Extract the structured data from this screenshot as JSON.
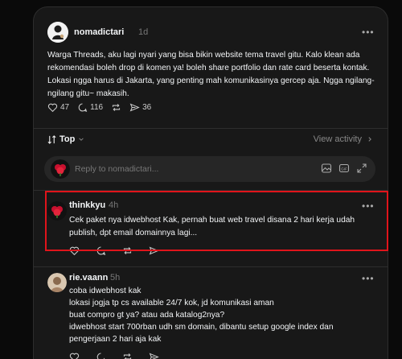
{
  "post": {
    "username": "nomadictari",
    "time": "1d",
    "more": "•••",
    "text": "Warga Threads, aku lagi nyari yang bisa bikin website tema travel gitu. Kalo klean ada rekomendasi boleh drop di komen ya! boleh share portfolio dan rate card beserta kontak. Lokasi ngga harus di Jakarta, yang penting mah komunikasinya gercep aja. Ngga ngilang-ngilang gitu~ makasih.",
    "likes": "47",
    "comments": "116",
    "shares": "36"
  },
  "sort": {
    "label": "Top",
    "view_activity": "View activity"
  },
  "reply": {
    "placeholder": "Reply to nomadictari..."
  },
  "comments": [
    {
      "username": "thinkkyu",
      "time": "4h",
      "more": "•••",
      "text": "Cek paket nya idwebhost Kak, pernah buat web travel disana 2 hari kerja udah publish, dpt email domainnya lagi..."
    },
    {
      "username": "rie.vaann",
      "time": "5h",
      "more": "•••",
      "lines": [
        "coba idwebhost kak",
        "lokasi jogja tp cs available 24/7 kok, jd komunikasi aman",
        "buat compro gt ya? atau ada katalog2nya?",
        "idwebhost start 700rban udh sm domain, dibantu setup google index dan",
        "pengerjaan 2 hari aja kak"
      ]
    }
  ],
  "colors": {
    "background": "#0a0a0a",
    "panel": "#181818",
    "highlight": "#e0141b",
    "text": "#f3f5f7",
    "muted": "#777777"
  }
}
